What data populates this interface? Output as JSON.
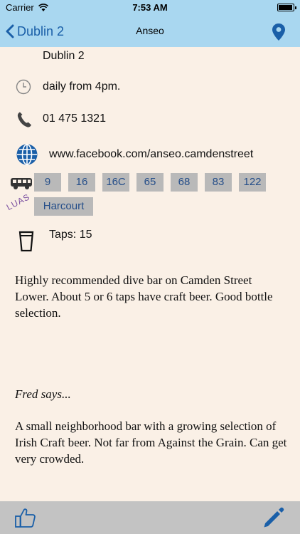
{
  "status_bar": {
    "carrier": "Carrier",
    "time": "7:53 AM"
  },
  "nav": {
    "back_label": "Dublin 2",
    "title": "Anseo"
  },
  "details": {
    "address": "Dublin 2",
    "hours": "daily from 4pm.",
    "phone": "01 475 1321",
    "website": "www.facebook.com/anseo.camdenstreet",
    "bus_routes": [
      "9",
      "16",
      "16C",
      "65",
      "68",
      "83",
      "122"
    ],
    "luas_label": "LUAS",
    "luas_stops": [
      "Harcourt"
    ],
    "taps": "Taps: 15"
  },
  "description": "Highly recommended dive bar on Camden Street Lower. About 5 or 6 taps have craft beer. Good bottle selection.",
  "review": {
    "author": "Fred says...",
    "text": "A small neighborhood bar with a growing selection of Irish Craft beer. Not far from Against the Grain. Can get very crowded."
  },
  "icons": {
    "clock": "clock-icon",
    "phone": "phone-icon",
    "web": "globe-icon",
    "bus": "bus-icon",
    "luas": "luas-logo",
    "taps": "pint-glass-icon",
    "map": "map-pin-icon",
    "like": "thumbs-up-icon",
    "edit": "pencil-icon"
  },
  "colors": {
    "nav_bg": "#a9d7f0",
    "content_bg": "#faf0e6",
    "chip_bg": "#b9b9b9",
    "chip_text": "#254e89",
    "toolbar_bg": "#c3c3c3",
    "accent": "#1a5fa8"
  }
}
